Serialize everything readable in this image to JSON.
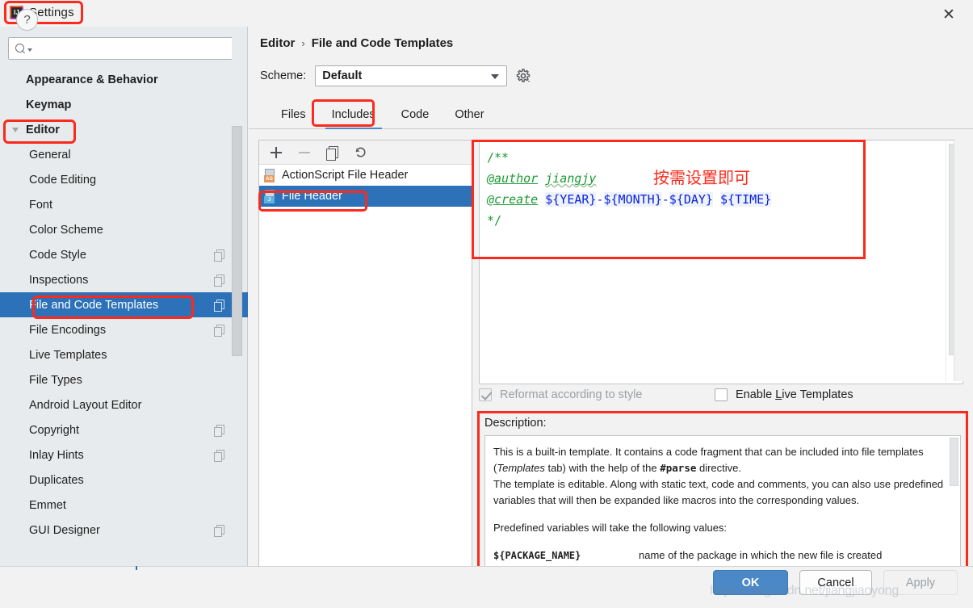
{
  "window": {
    "title": "Settings",
    "app_icon": "intellij-idea-icon",
    "close_icon": "close-icon"
  },
  "sidebar": {
    "search": {
      "placeholder": "",
      "value": "",
      "icon": "search-icon"
    },
    "items": [
      {
        "label": "Appearance & Behavior",
        "level": 1,
        "arrow": "right",
        "bold": true,
        "selected": false,
        "copy": false
      },
      {
        "label": "Keymap",
        "level": 1,
        "arrow": "none",
        "bold": true,
        "selected": false,
        "copy": false
      },
      {
        "label": "Editor",
        "level": 1,
        "arrow": "down",
        "bold": true,
        "selected": false,
        "copy": false
      },
      {
        "label": "General",
        "level": 2,
        "arrow": "right",
        "bold": false,
        "selected": false,
        "copy": false
      },
      {
        "label": "Code Editing",
        "level": 2,
        "arrow": "none",
        "bold": false,
        "selected": false,
        "copy": false
      },
      {
        "label": "Font",
        "level": 2,
        "arrow": "none",
        "bold": false,
        "selected": false,
        "copy": false
      },
      {
        "label": "Color Scheme",
        "level": 2,
        "arrow": "right",
        "bold": false,
        "selected": false,
        "copy": false
      },
      {
        "label": "Code Style",
        "level": 2,
        "arrow": "right",
        "bold": false,
        "selected": false,
        "copy": true
      },
      {
        "label": "Inspections",
        "level": 2,
        "arrow": "none",
        "bold": false,
        "selected": false,
        "copy": true
      },
      {
        "label": "File and Code Templates",
        "level": 2,
        "arrow": "none",
        "bold": false,
        "selected": true,
        "copy": true
      },
      {
        "label": "File Encodings",
        "level": 2,
        "arrow": "none",
        "bold": false,
        "selected": false,
        "copy": true
      },
      {
        "label": "Live Templates",
        "level": 2,
        "arrow": "none",
        "bold": false,
        "selected": false,
        "copy": false
      },
      {
        "label": "File Types",
        "level": 2,
        "arrow": "none",
        "bold": false,
        "selected": false,
        "copy": false
      },
      {
        "label": "Android Layout Editor",
        "level": 2,
        "arrow": "none",
        "bold": false,
        "selected": false,
        "copy": false
      },
      {
        "label": "Copyright",
        "level": 2,
        "arrow": "right",
        "bold": false,
        "selected": false,
        "copy": true
      },
      {
        "label": "Inlay Hints",
        "level": 2,
        "arrow": "right",
        "bold": false,
        "selected": false,
        "copy": true
      },
      {
        "label": "Duplicates",
        "level": 2,
        "arrow": "none",
        "bold": false,
        "selected": false,
        "copy": false
      },
      {
        "label": "Emmet",
        "level": 2,
        "arrow": "right",
        "bold": false,
        "selected": false,
        "copy": false
      },
      {
        "label": "GUI Designer",
        "level": 2,
        "arrow": "none",
        "bold": false,
        "selected": false,
        "copy": true
      }
    ]
  },
  "main": {
    "breadcrumb": {
      "parent": "Editor",
      "separator": "›",
      "current": "File and Code Templates"
    },
    "scheme": {
      "label": "Scheme:",
      "value": "Default",
      "gear_icon": "gear-icon"
    },
    "tabs": [
      {
        "label": "Files",
        "active": false
      },
      {
        "label": "Includes",
        "active": true
      },
      {
        "label": "Code",
        "active": false
      },
      {
        "label": "Other",
        "active": false
      }
    ],
    "list_toolbar": [
      {
        "icon": "plus-icon",
        "name": "add-template-button"
      },
      {
        "icon": "minus-icon",
        "name": "remove-template-button"
      },
      {
        "icon": "copy-icon",
        "name": "copy-template-button"
      },
      {
        "icon": "undo-icon",
        "name": "reset-template-button"
      }
    ],
    "templates": [
      {
        "label": "ActionScript File Header",
        "badge": "AS",
        "selected": false
      },
      {
        "label": "File Header",
        "badge": "J",
        "selected": true
      }
    ],
    "code": {
      "lines": [
        {
          "segments": [
            {
              "text": "/**",
              "style": "green"
            }
          ]
        },
        {
          "segments": [
            {
              "text": "@author",
              "style": "tag"
            },
            {
              "text": " ",
              "style": "plainspace"
            },
            {
              "text": "jiangjy",
              "style": "ital-squiggle"
            }
          ]
        },
        {
          "segments": [
            {
              "text": "@create",
              "style": "tag"
            },
            {
              "text": " ",
              "style": "plainspace"
            },
            {
              "text": "${YEAR}",
              "style": "var"
            },
            {
              "text": "-",
              "style": "blue"
            },
            {
              "text": "${MONTH}",
              "style": "var"
            },
            {
              "text": "-",
              "style": "blue"
            },
            {
              "text": "${DAY}",
              "style": "var"
            },
            {
              "text": " ",
              "style": "plainspace"
            },
            {
              "text": "${TIME}",
              "style": "var"
            }
          ]
        },
        {
          "segments": [
            {
              "text": "*/",
              "style": "green"
            }
          ]
        }
      ],
      "annotation": "按需设置即可"
    },
    "checkboxes": [
      {
        "label": "Reformat according to style",
        "checked": true,
        "disabled": true,
        "mnemonic": ""
      },
      {
        "label": "Enable Live Templates",
        "checked": false,
        "disabled": false,
        "mnemonic": "L"
      }
    ],
    "description": {
      "title": "Description:",
      "para1_a": "This is a built-in template. It contains a code fragment that can be included into file templates (",
      "para1_em": "Templates",
      "para1_b": " tab) with the help of the ",
      "para1_code": "#parse",
      "para1_c": " directive.",
      "para2": "The template is editable. Along with static text, code and comments, you can also use predefined variables that will then be expanded like macros into the corresponding values.",
      "para3": "Predefined variables will take the following values:",
      "variables": [
        {
          "name": "${PACKAGE_NAME}",
          "desc": "name of the package in which the new file is created"
        }
      ]
    }
  },
  "footer": {
    "help_icon": "help-icon",
    "help_label": "?",
    "ok": "OK",
    "cancel": "Cancel",
    "apply": "Apply",
    "watermark": "https://blog.csdn.net/jiangjiaoyong"
  },
  "colors": {
    "accent": "#2d71b8",
    "annotation_red": "#fb2a1c",
    "ok_button": "#4a88c7",
    "sidebar_bg": "#e8ebed",
    "code_green": "#1a9a32",
    "code_blue": "#0a22d8"
  }
}
